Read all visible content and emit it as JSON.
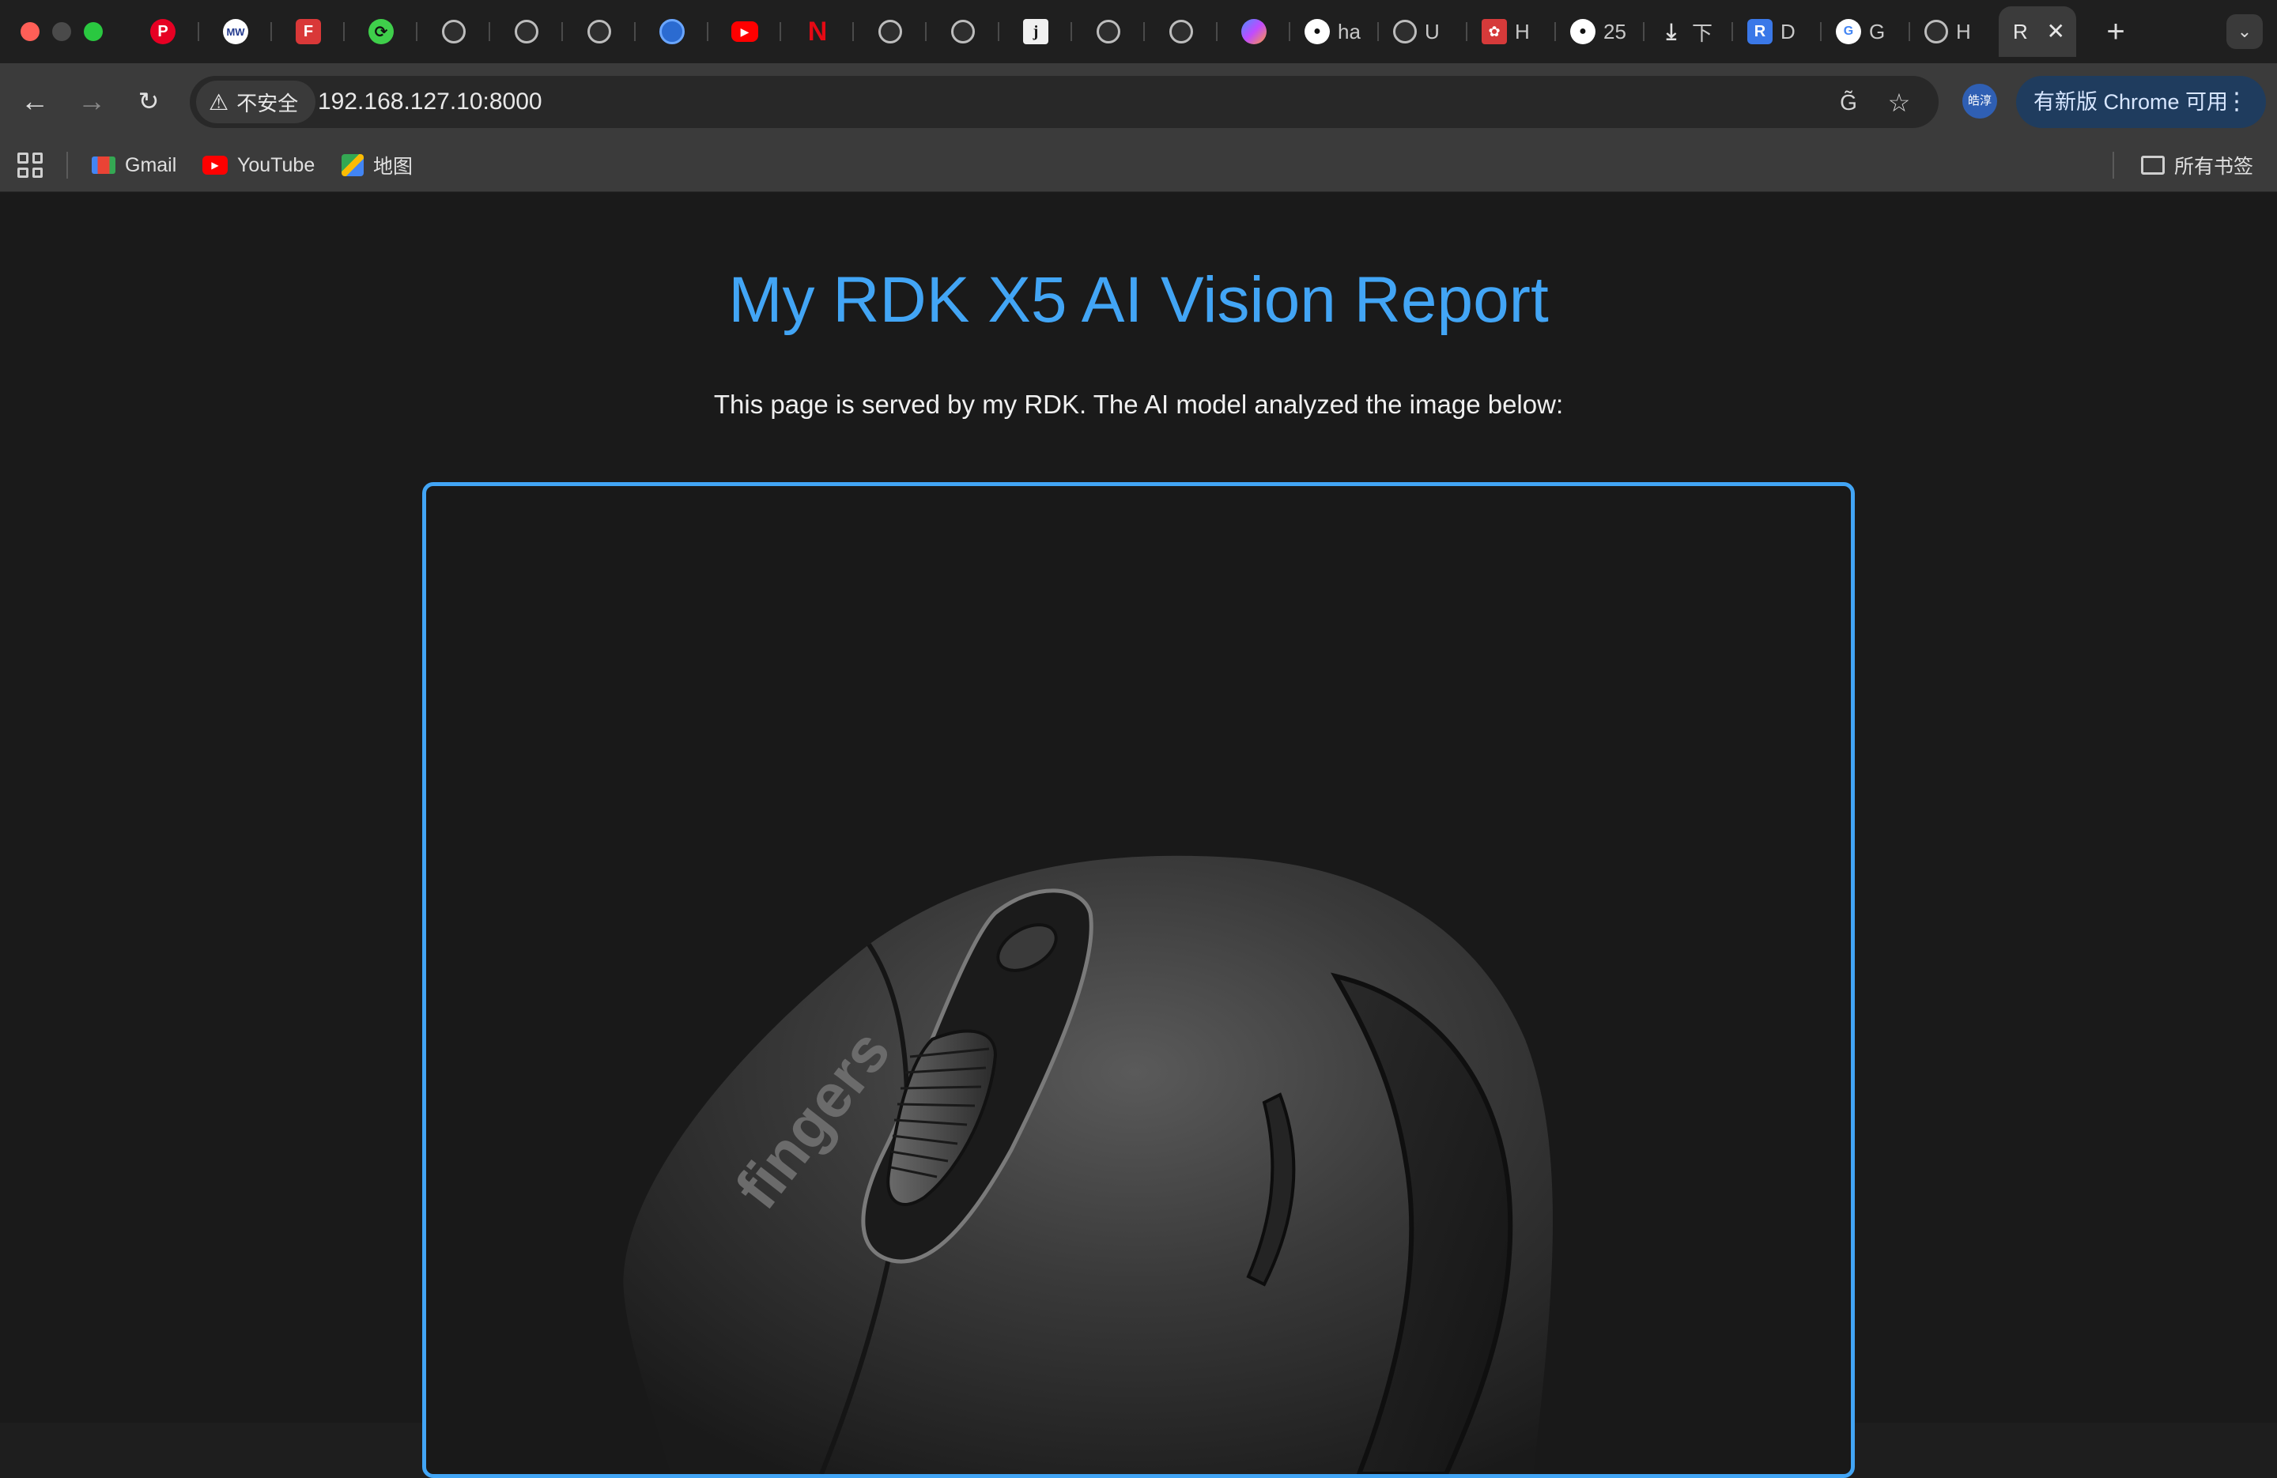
{
  "browser": {
    "tabs": [
      {
        "icon": "pinterest-icon",
        "title": ""
      },
      {
        "icon": "merriam-webster-icon",
        "title": ""
      },
      {
        "icon": "f-app-icon",
        "title": ""
      },
      {
        "icon": "sync-icon",
        "title": ""
      },
      {
        "icon": "globe-icon",
        "title": ""
      },
      {
        "icon": "globe-icon",
        "title": ""
      },
      {
        "icon": "globe-icon",
        "title": ""
      },
      {
        "icon": "web-globe-icon",
        "title": ""
      },
      {
        "icon": "youtube-icon",
        "title": ""
      },
      {
        "icon": "netflix-icon",
        "title": ""
      },
      {
        "icon": "globe-icon",
        "title": ""
      },
      {
        "icon": "globe-icon",
        "title": ""
      },
      {
        "icon": "j-icon",
        "title": ""
      },
      {
        "icon": "globe-icon",
        "title": ""
      },
      {
        "icon": "globe-icon",
        "title": ""
      },
      {
        "icon": "copilot-icon",
        "title": ""
      },
      {
        "icon": "github-icon",
        "title": "ha"
      },
      {
        "icon": "globe-icon",
        "title": "U"
      },
      {
        "icon": "huawei-icon",
        "title": "H"
      },
      {
        "icon": "github-icon",
        "title": "25"
      },
      {
        "icon": "download-icon",
        "title": "下"
      },
      {
        "icon": "rq-icon",
        "title": "D"
      },
      {
        "icon": "google-key-icon",
        "title": "G"
      },
      {
        "icon": "globe-icon",
        "title": "H"
      }
    ],
    "active_tab": {
      "title": "R",
      "close": "✕"
    },
    "new_tab": "+",
    "security_label": "不安全",
    "url": "192.168.127.10:8000",
    "profile_initials": "皓淳",
    "update_label": "有新版 Chrome 可用"
  },
  "bookmarks": {
    "items": [
      {
        "label": "Gmail"
      },
      {
        "label": "YouTube"
      },
      {
        "label": "地图"
      }
    ],
    "all_bookmarks": "所有书签"
  },
  "page": {
    "title": "My RDK X5 AI Vision Report",
    "description": "This page is served by my RDK. The AI model analyzed the image below:",
    "image_brand_text": "fingers"
  },
  "colors": {
    "accent": "#42a5f5",
    "page_bg": "#1a1a1a"
  }
}
